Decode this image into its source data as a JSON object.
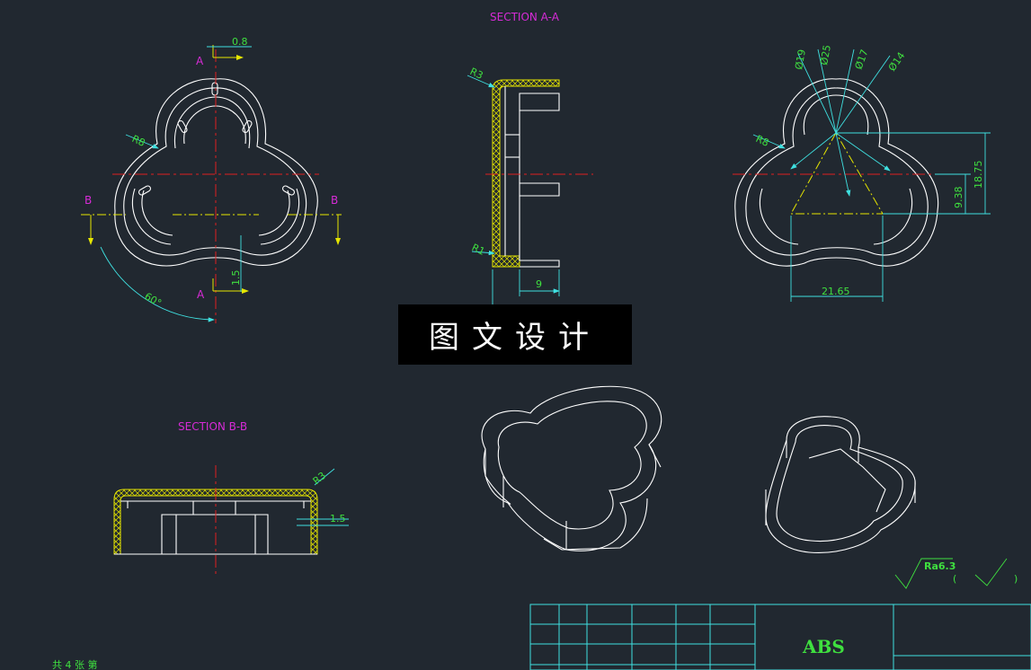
{
  "sections": {
    "a_title": "SECTION A-A",
    "b_title": "SECTION B-B"
  },
  "front_view": {
    "cut_label_a": "A",
    "cut_label_b": "B",
    "dim_top": "0.8",
    "dim_radius": "R8",
    "dim_angle": "60°",
    "dim_bottom": "1.5"
  },
  "section_a": {
    "dim_r3": "R3",
    "dim_r1": "R1",
    "dim_width": "9"
  },
  "right_view": {
    "dim_d19": "Ø19",
    "dim_d25": "Ø25",
    "dim_d17": "Ø17",
    "dim_d14": "Ø14",
    "dim_r8": "R8",
    "dim_h1": "18.75",
    "dim_h2": "9.38",
    "dim_w": "21.65"
  },
  "section_b": {
    "dim_r3": "R3",
    "dim_t": "1.5"
  },
  "surface_finish": {
    "value": "Ra6.3"
  },
  "title_block": {
    "material": "ABS"
  },
  "watermark": {
    "text": "图文设计"
  },
  "footer_text": "共 4 张 第"
}
